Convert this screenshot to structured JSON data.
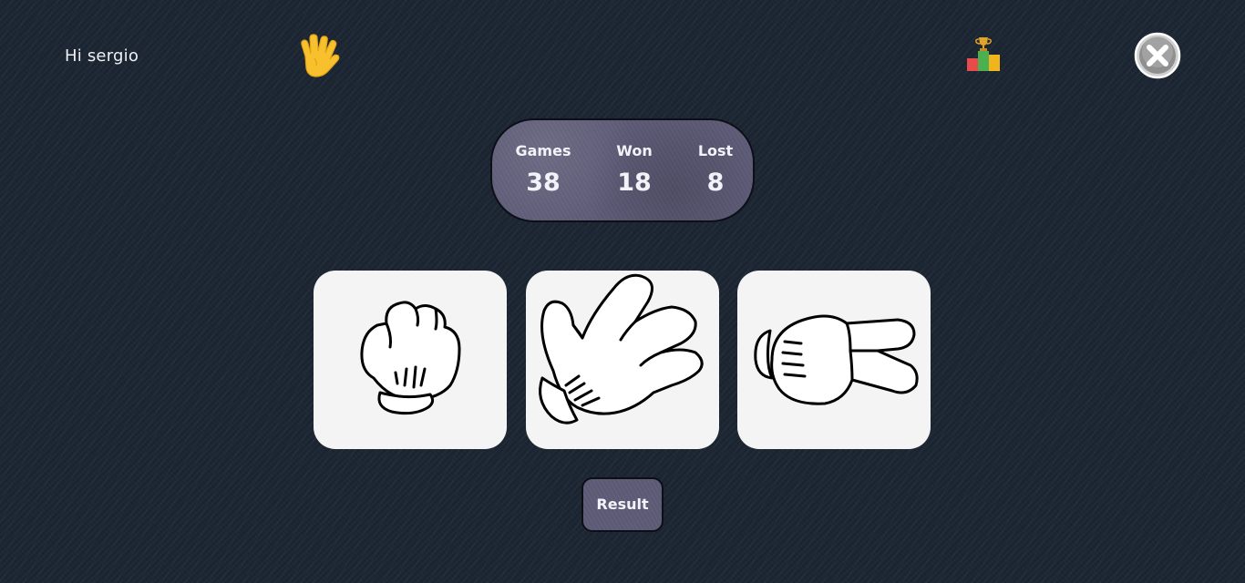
{
  "header": {
    "greeting": "Hi sergio",
    "logo_icon": "vulcan-salute-icon",
    "leaderboard_icon": "podium-trophy-icon",
    "close_icon": "close-circle-icon"
  },
  "scoreboard": {
    "games_label": "Games",
    "games_value": "38",
    "won_label": "Won",
    "won_value": "18",
    "lost_label": "Lost",
    "lost_value": "8"
  },
  "choices": [
    {
      "id": "rock",
      "icon": "fist-glove-icon"
    },
    {
      "id": "spock",
      "icon": "vulcan-glove-icon"
    },
    {
      "id": "scissors",
      "icon": "scissors-glove-icon"
    }
  ],
  "actions": {
    "result_label": "Result"
  },
  "colors": {
    "background": "#1c2633",
    "panel": "#5c5a75",
    "card": "#f4f4f4",
    "text": "#f3f2f8"
  }
}
